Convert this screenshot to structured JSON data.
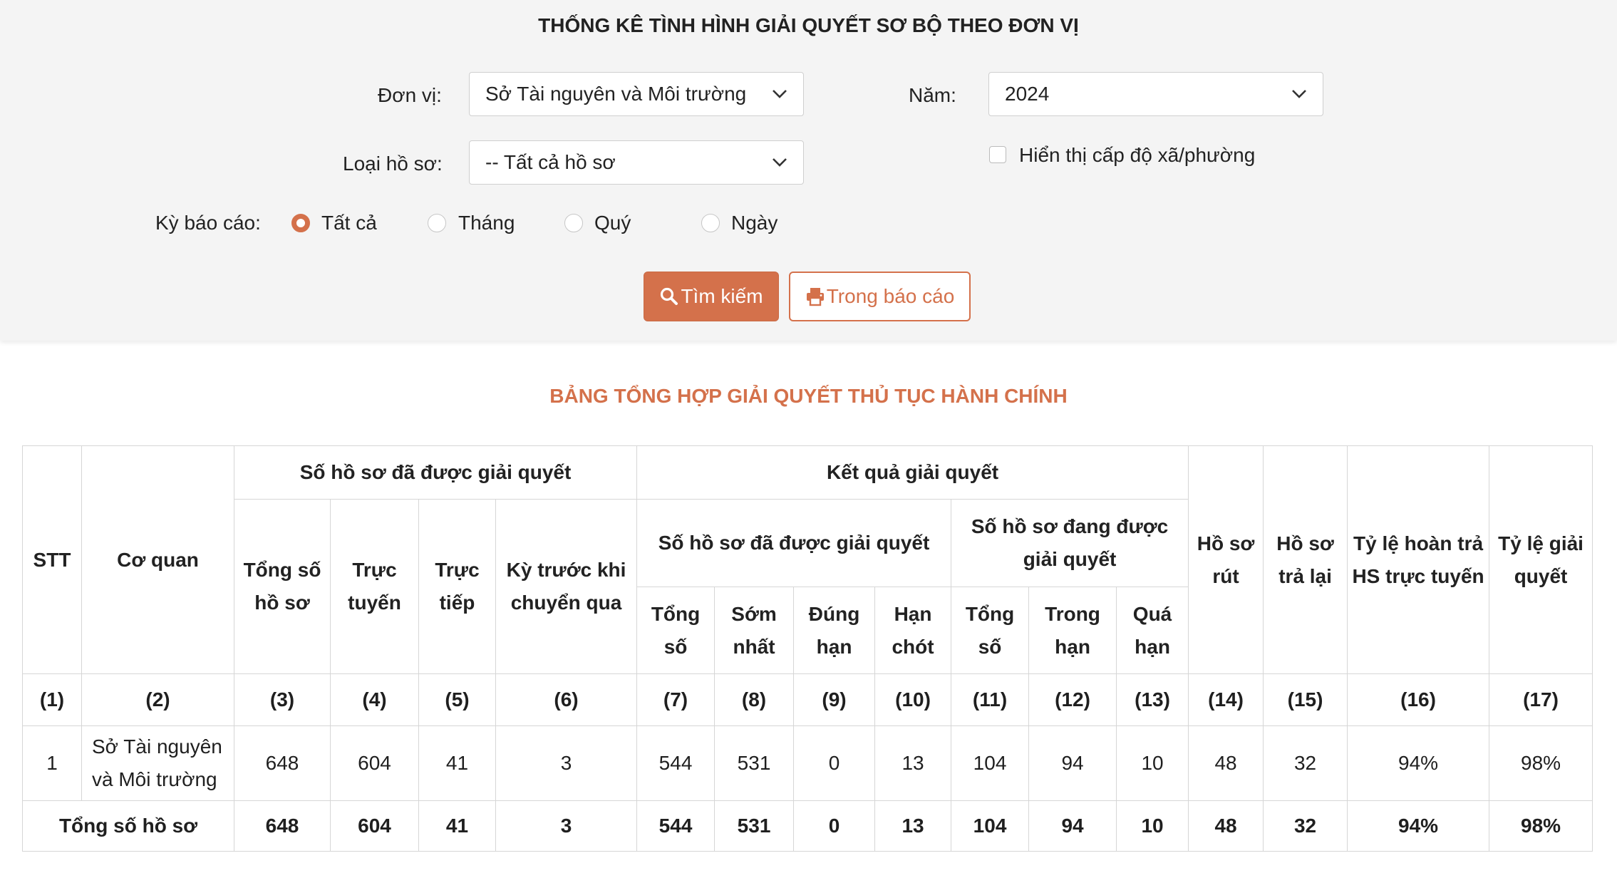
{
  "header": {
    "title": "THỐNG KÊ TÌNH HÌNH GIẢI QUYẾT SƠ BỘ THEO ĐƠN VỊ"
  },
  "filters": {
    "don_vi_label": "Đơn vị:",
    "don_vi_value": "Sở Tài nguyên và Môi trường",
    "nam_label": "Năm:",
    "nam_value": "2024",
    "loai_ho_so_label": "Loại hồ sơ:",
    "loai_ho_so_value": "-- Tất cả hồ sơ",
    "show_ward_label": "Hiển thị cấp độ xã/phường",
    "show_ward_checked": false,
    "ky_bao_cao_label": "Kỳ báo cáo:",
    "ky_options": [
      {
        "label": "Tất cả",
        "checked": true
      },
      {
        "label": "Tháng",
        "checked": false
      },
      {
        "label": "Quý",
        "checked": false
      },
      {
        "label": "Ngày",
        "checked": false
      }
    ]
  },
  "actions": {
    "search_label": "Tìm kiếm",
    "search_icon": "search-icon",
    "print_label": "Trong báo cáo",
    "print_icon": "printer-icon"
  },
  "accent_color": "#d4714b",
  "report": {
    "title": "BẢNG TỔNG HỢP GIẢI QUYẾT THỦ TỤC HÀNH CHÍNH",
    "headers": {
      "stt": "STT",
      "co_quan": "Cơ quan",
      "so_hs_da_giai_quyet": "Số hồ sơ đã được giải quyết",
      "tong_so_ho_so": "Tổng số hồ sơ",
      "truc_tuyen": "Trực tuyến",
      "truc_tiep": "Trực tiếp",
      "ky_truoc": "Kỳ trước khi chuyển qua",
      "ket_qua": "Kết quả giải quyết",
      "kq_da_giai_quyet": "Số hồ sơ đã được giải quyết",
      "kq_dang_giai_quyet": "Số hồ sơ đang được giải quyết",
      "tong_so": "Tổng số",
      "som_nhat": "Sớm nhất",
      "dung_han": "Đúng hạn",
      "han_chot": "Hạn chót",
      "tong_so_2": "Tổng số",
      "trong_han": "Trong hạn",
      "qua_han": "Quá hạn",
      "ho_so_rut": "Hồ sơ rút",
      "ho_so_tra_lai": "Hồ sơ trả lại",
      "ty_le_hoan_tra": "Tỷ lệ hoàn trả HS trực tuyến",
      "ty_le_giai_quyet": "Tỷ lệ giải quyết"
    },
    "column_numbers": [
      "(1)",
      "(2)",
      "(3)",
      "(4)",
      "(5)",
      "(6)",
      "(7)",
      "(8)",
      "(9)",
      "(10)",
      "(11)",
      "(12)",
      "(13)",
      "(14)",
      "(15)",
      "(16)",
      "(17)"
    ],
    "rows": [
      {
        "cells": [
          "1",
          "Sở Tài nguyên và Môi trường",
          "648",
          "604",
          "41",
          "3",
          "544",
          "531",
          "0",
          "13",
          "104",
          "94",
          "10",
          "48",
          "32",
          "94%",
          "98%"
        ]
      }
    ],
    "total": {
      "label": "Tổng số hồ sơ",
      "cells": [
        "648",
        "604",
        "41",
        "3",
        "544",
        "531",
        "0",
        "13",
        "104",
        "94",
        "10",
        "48",
        "32",
        "94%",
        "98%"
      ]
    }
  }
}
